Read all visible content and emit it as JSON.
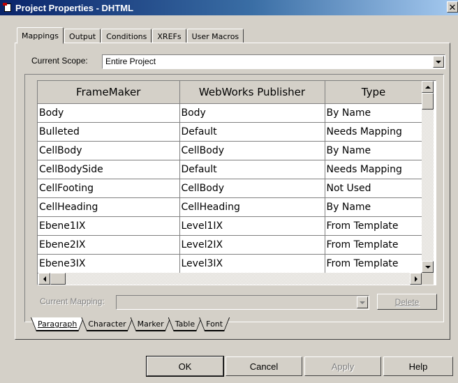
{
  "window": {
    "title": "Project Properties - DHTML"
  },
  "tabs": [
    "Mappings",
    "Output",
    "Conditions",
    "XREFs",
    "User Macros"
  ],
  "scope": {
    "label": "Current Scope:",
    "value": "Entire Project"
  },
  "grid": {
    "headers": [
      "FrameMaker",
      "WebWorks Publisher",
      "Type"
    ],
    "rows": [
      [
        "Body",
        "Body",
        "By Name"
      ],
      [
        "Bulleted",
        "Default",
        "Needs Mapping"
      ],
      [
        "CellBody",
        "CellBody",
        "By Name"
      ],
      [
        "CellBodySide",
        "Default",
        "Needs Mapping"
      ],
      [
        "CellFooting",
        "CellBody",
        "Not Used"
      ],
      [
        "CellHeading",
        "CellHeading",
        "By Name"
      ],
      [
        "Ebene1IX",
        "Level1IX",
        "From Template"
      ],
      [
        "Ebene2IX",
        "Level2IX",
        "From Template"
      ],
      [
        "Ebene3IX",
        "Level3IX",
        "From Template"
      ]
    ]
  },
  "current_mapping": {
    "label": "Current Mapping:",
    "value": ""
  },
  "delete_label": "Delete",
  "bottom_tabs": [
    "Paragraph",
    "Character",
    "Marker",
    "Table",
    "Font"
  ],
  "buttons": {
    "ok": "OK",
    "cancel": "Cancel",
    "apply": "Apply",
    "help": "Help"
  }
}
